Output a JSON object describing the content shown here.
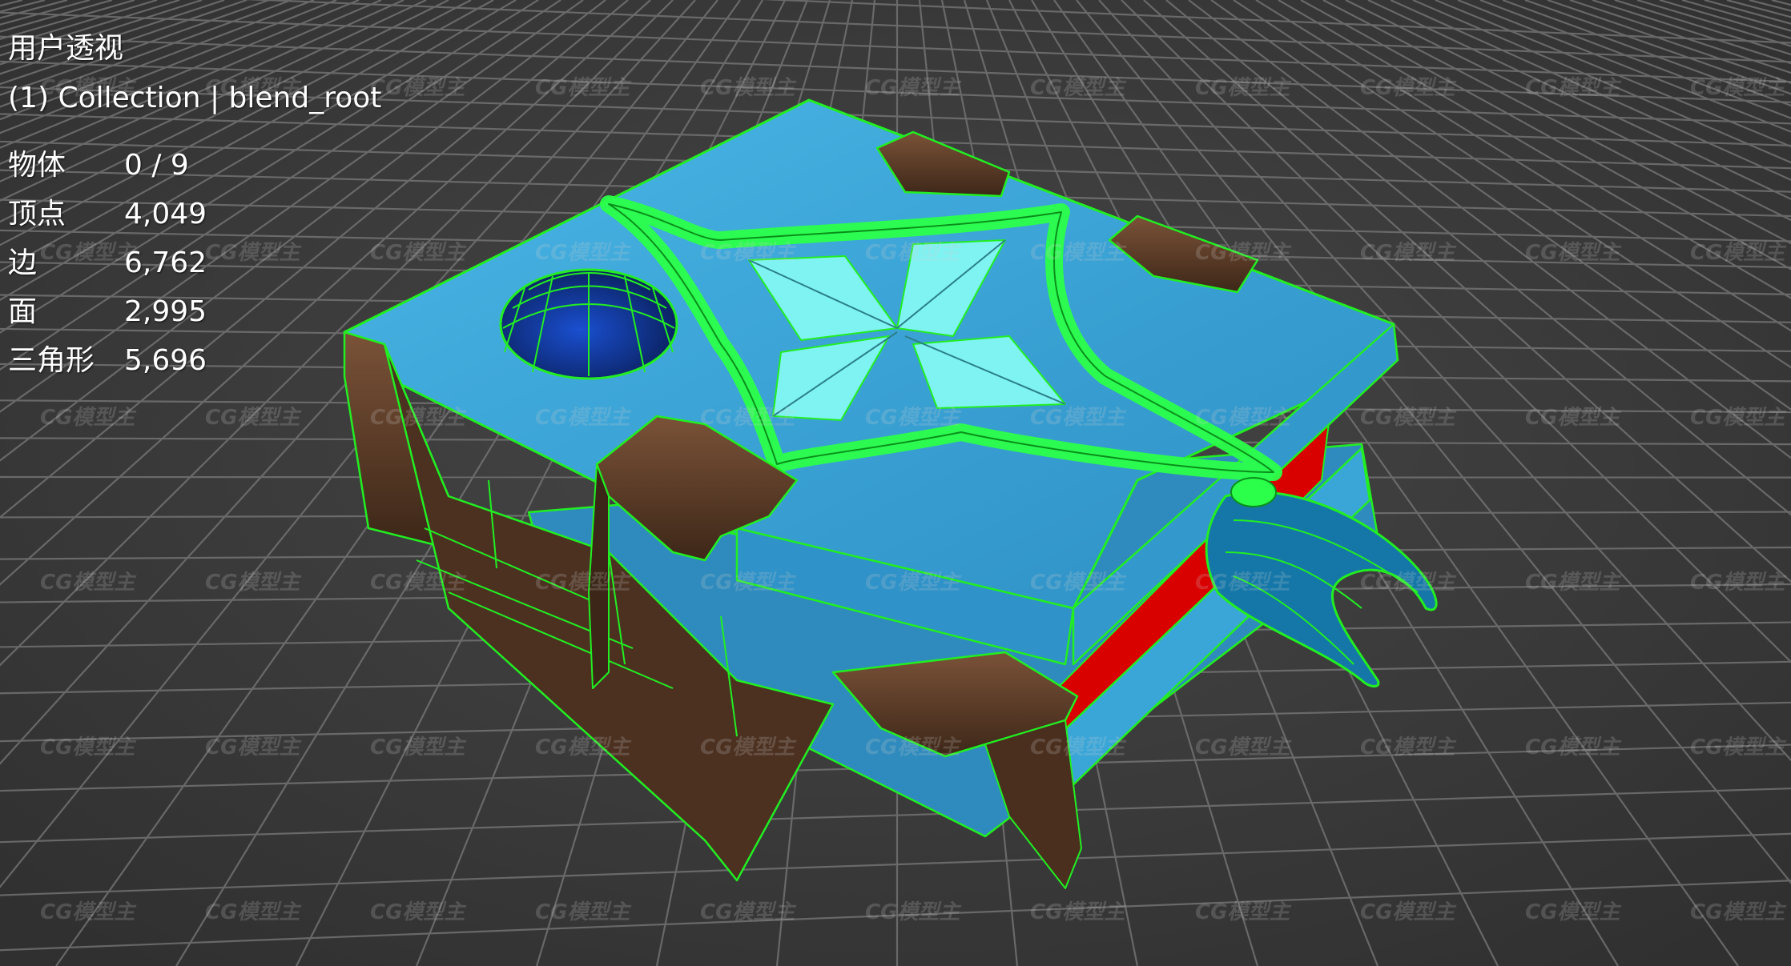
{
  "viewport": {
    "view_name": "用户透视",
    "collection_info": "(1) Collection | blend_root"
  },
  "stats": [
    {
      "label": "物体",
      "value": "0 / 9"
    },
    {
      "label": "顶点",
      "value": "4,049"
    },
    {
      "label": "边",
      "value": "6,762"
    },
    {
      "label": "面",
      "value": "2,995"
    },
    {
      "label": "三角形",
      "value": "5,696"
    }
  ],
  "watermark_text": "CG模型主",
  "colors": {
    "background": "#3d3d3d",
    "grid": "#7a7a7a",
    "wire": "#22ee22",
    "cover_blue": "#3aa6d8",
    "emblem_cyan": "#7ff2f2",
    "leather_brown": "#5d3c28",
    "page_red": "#d90000"
  }
}
